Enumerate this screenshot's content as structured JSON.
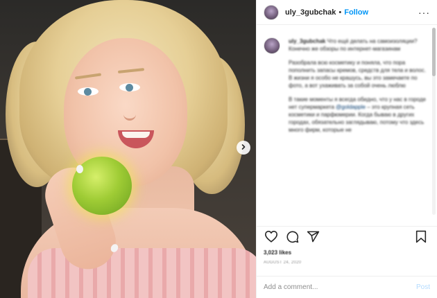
{
  "header": {
    "username": "uly_3gubchak",
    "separator": "•",
    "follow_label": "Follow",
    "more_label": "···"
  },
  "caption": {
    "username": "uly_3gubchak",
    "paragraphs": [
      "Что ещё делать на самоизоляции? Конечно же обзоры по интернет-магазинам",
      "Разобрала всю косметику и поняла, что пора пополнить запасы кремов, средств для тела и волос. В жизни я особо не крашусь, вы это замечаете по фото, а вот ухаживать за собой очень люблю",
      "В такие моменты я всегда обидно, что у нас в городе нет супермаркета",
      "– это крупная сеть косметики и парфюмерии. Когда бываю в других городах, обязательно заглядываю, потому что здесь много фирм, которые не"
    ],
    "mention": "@goldapple"
  },
  "engagement": {
    "likes": "3,023 likes",
    "date": "AUGUST 24, 2020"
  },
  "comment": {
    "placeholder": "Add a comment...",
    "post_label": "Post"
  },
  "icons": {
    "like": "heart-icon",
    "comment": "comment-icon",
    "share": "share-icon",
    "save": "bookmark-icon",
    "next": "chevron-right-icon"
  },
  "colors": {
    "accent": "#0095f6",
    "text": "#262626",
    "muted": "#8e8e8e",
    "post_disabled": "#b3dbff"
  }
}
